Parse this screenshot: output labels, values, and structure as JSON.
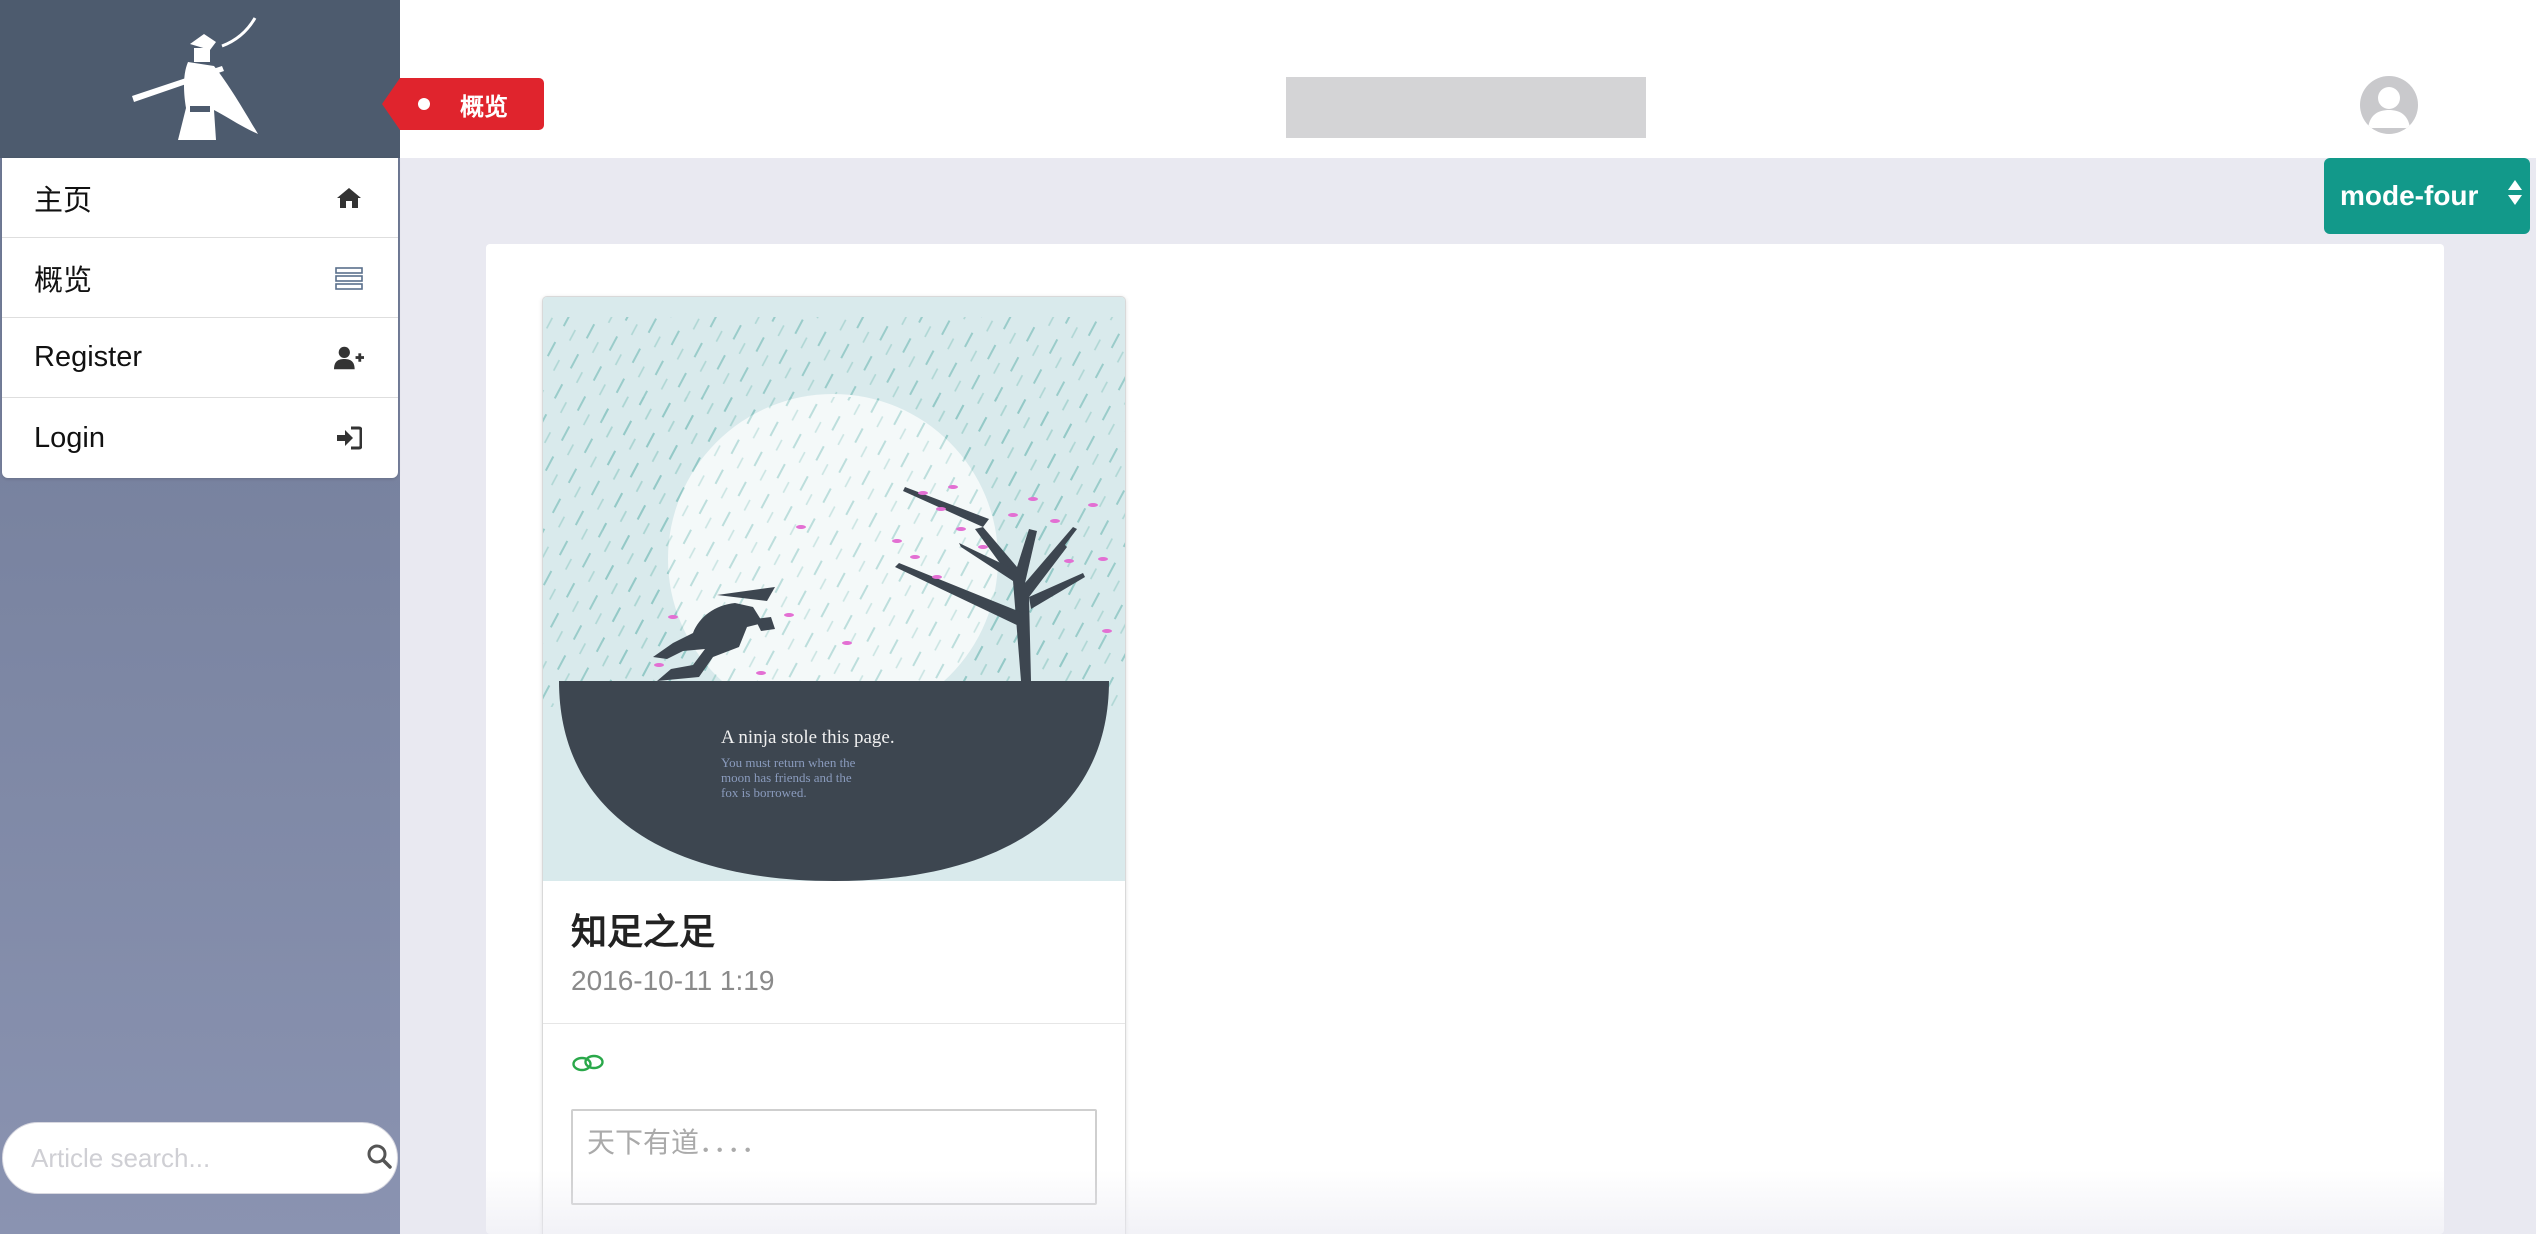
{
  "sidebar": {
    "menu": [
      {
        "label": "主页",
        "icon": "home-icon"
      },
      {
        "label": "概览",
        "icon": "list-icon"
      },
      {
        "label": "Register",
        "icon": "user-plus-icon"
      },
      {
        "label": "Login",
        "icon": "sign-in-icon"
      }
    ],
    "search": {
      "placeholder": "Article search..."
    }
  },
  "header": {
    "page_tag": "概览",
    "mode_select": {
      "selected": "mode-four"
    }
  },
  "article_card": {
    "image_caption_title": "A ninja stole this page.",
    "image_caption_lines": [
      "You must return when the",
      "moon has friends and the",
      "fox is borrowed."
    ],
    "title": "知足之足",
    "date": "2016-10-11 1:19",
    "comment_placeholder": "天下有道．．．．"
  },
  "colors": {
    "sidebar_header": "#4d5b6e",
    "tag_red": "#e0242d",
    "mode_teal": "#12998a",
    "accent_green": "#2aa84a"
  }
}
